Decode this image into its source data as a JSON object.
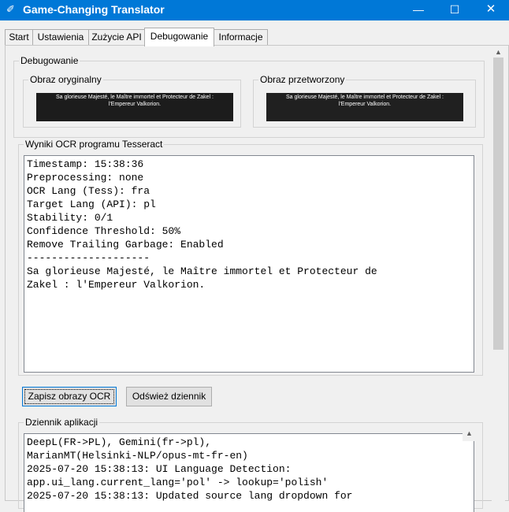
{
  "window": {
    "title": "Game-Changing Translator",
    "app_icon": "feather-icon",
    "minimize": "—",
    "maximize": "☐",
    "close": "✕"
  },
  "tabs": [
    "Start",
    "Ustawienia",
    "Zużycie API",
    "Debugowanie",
    "Informacje"
  ],
  "active_tab": "Debugowanie",
  "debug": {
    "section_label": "Debugowanie",
    "original_image_label": "Obraz oryginalny",
    "processed_image_label": "Obraz przetworzony",
    "image_caption_line1": "Sa glorieuse Majesté, le Maître immortel et Protecteur de Zakel :",
    "image_caption_line2": "l'Empereur Valkorion.",
    "ocr_results_label": "Wyniki OCR programu Tesseract",
    "ocr_lines": [
      "Timestamp: 15:38:36",
      "Preprocessing: none",
      "OCR Lang (Tess): fra",
      "Target Lang (API): pl",
      "Stability: 0/1",
      "Confidence Threshold: 50%",
      "Remove Trailing Garbage: Enabled",
      "--------------------",
      "Sa glorieuse Majesté, le Maître immortel et Protecteur de",
      "Zakel : l'Empereur Valkorion."
    ],
    "save_button": "Zapisz obrazy OCR",
    "refresh_button": "Odśwież dziennik",
    "app_log_label": "Dziennik aplikacji",
    "log_lines": [
      "DeepL(FR->PL), Gemini(fr->pl),",
      "MarianMT(Helsinki-NLP/opus-mt-fr-en)",
      "2025-07-20 15:38:13: UI Language Detection:",
      "app.ui_lang.current_lang='pol' -> lookup='polish'",
      "2025-07-20 15:38:13: Updated source lang dropdown for"
    ]
  },
  "colors": {
    "titlebar": "#0078d7",
    "window_bg": "#f0f0f0",
    "focus_border": "#0078d7"
  }
}
